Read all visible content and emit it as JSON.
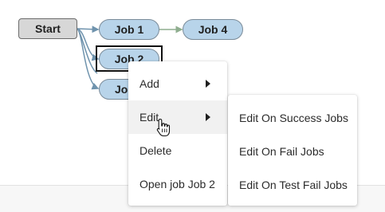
{
  "nodes": {
    "start": "Start",
    "job1": "Job 1",
    "job4": "Job 4",
    "job2": "Job 2",
    "job3": "Jo"
  },
  "context_menu": {
    "add": "Add",
    "edit": "Edit",
    "delete": "Delete",
    "open_job": "Open job Job 2"
  },
  "edit_submenu": {
    "on_success": "Edit On Success Jobs",
    "on_fail": "Edit On Fail Jobs",
    "on_test_fail": "Edit On Test Fail Jobs"
  },
  "colors": {
    "job_fill": "#b8d4ea",
    "start_fill": "#d7d7d7",
    "edge_blue": "#6f93ad",
    "edge_green": "#8fae8f"
  },
  "cursor": "hand-pointer-icon"
}
